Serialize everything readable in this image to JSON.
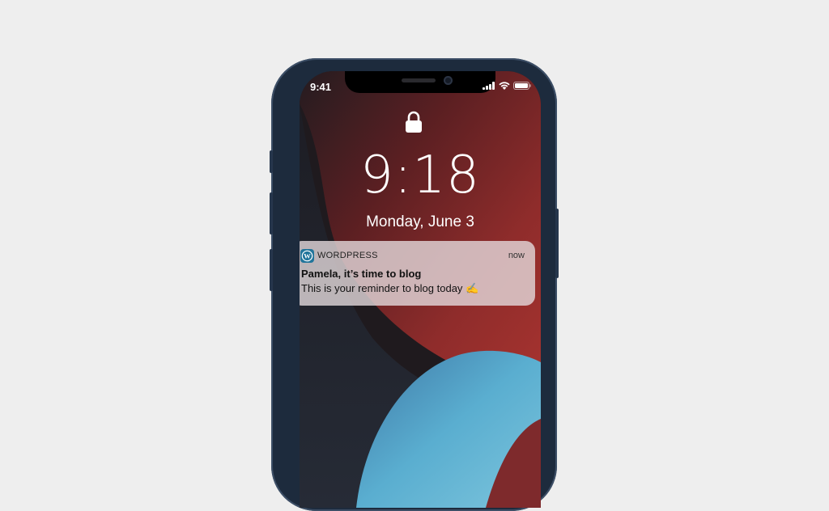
{
  "status_bar": {
    "time": "9:41",
    "icons": [
      "cellular-signal-icon",
      "wifi-icon",
      "battery-icon"
    ]
  },
  "lock_screen": {
    "lock_icon": "lock-icon",
    "clock": "9:18",
    "date": "Monday, June 3"
  },
  "notification": {
    "app_icon": "wordpress-icon",
    "app_name": "WORDPRESS",
    "time": "now",
    "title": "Pamela, it’s time to blog",
    "body": "This is your reminder to blog today ✍️"
  },
  "colors": {
    "background": "#eeeeee",
    "phone_frame": "#1d2b3d",
    "wordpress_blue": "#21759b",
    "wallpaper_red": "#8a2a2a",
    "wallpaper_blue": "#4a9ac0"
  }
}
